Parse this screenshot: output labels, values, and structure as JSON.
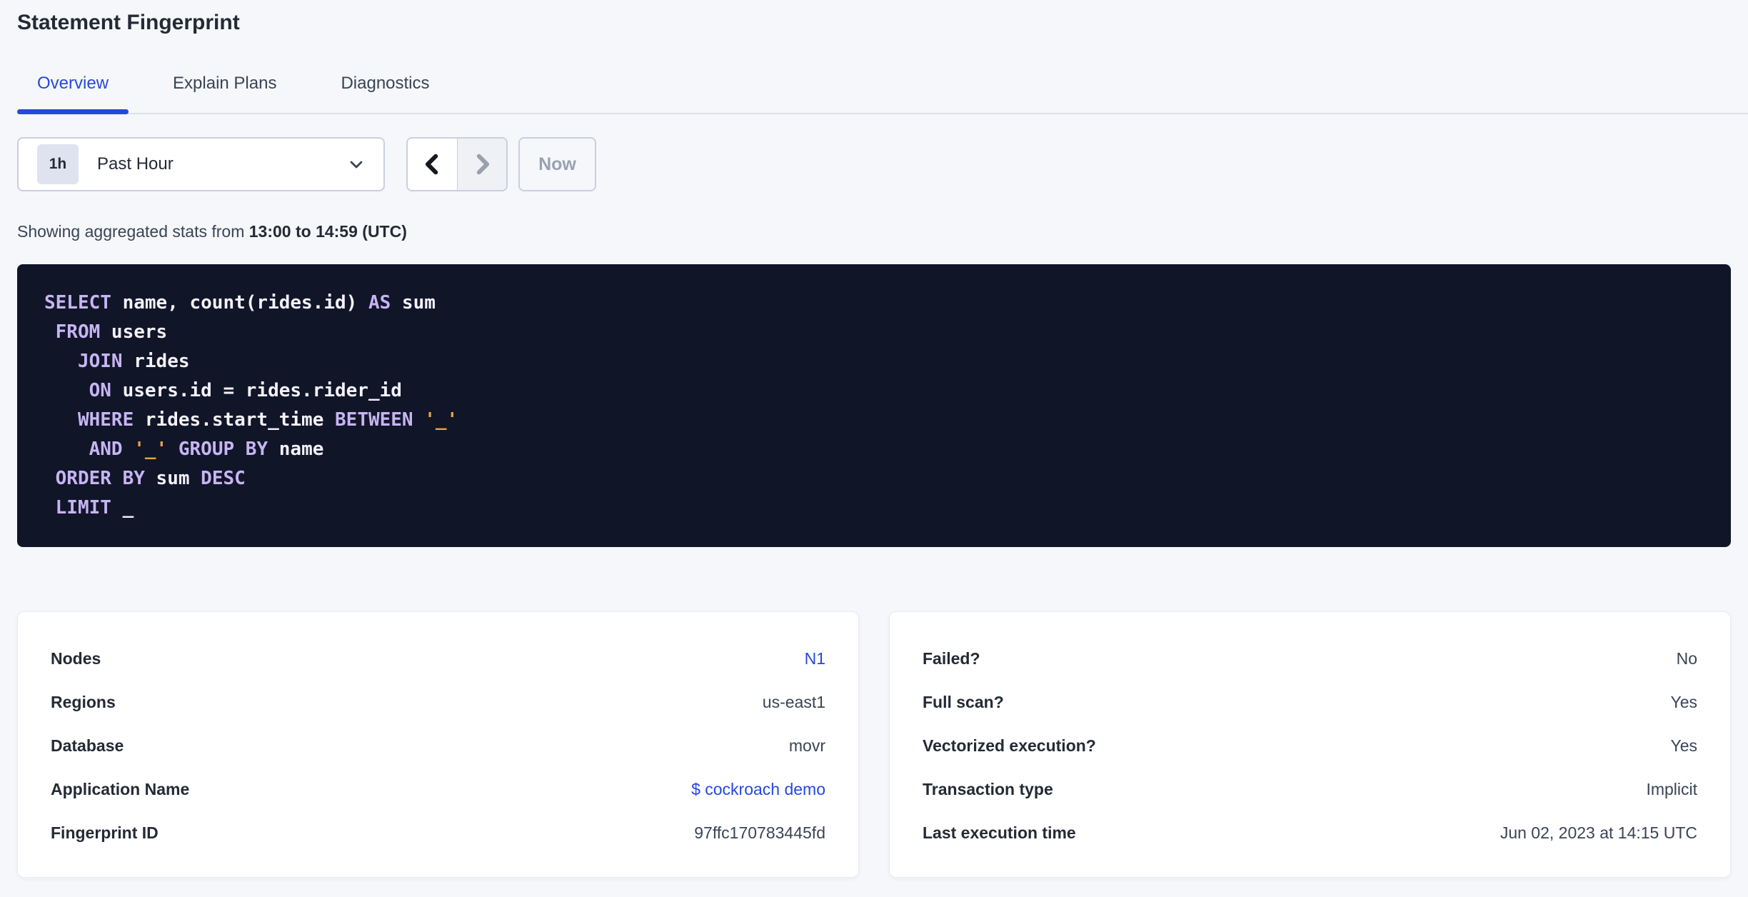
{
  "page": {
    "title": "Statement Fingerprint"
  },
  "colors": {
    "page_bg": "#f5f7fa",
    "accent_blue": "#2747e0",
    "text_dark": "#242a35",
    "text_base": "#394455",
    "code_bg": "#101528",
    "code_keyword": "#c7b5f2",
    "code_plain": "#f3f1fa",
    "code_literal": "#e8a24b"
  },
  "tabs": [
    {
      "id": "overview",
      "label": "Overview",
      "active": true
    },
    {
      "id": "explain-plans",
      "label": "Explain Plans",
      "active": false
    },
    {
      "id": "diagnostics",
      "label": "Diagnostics",
      "active": false
    }
  ],
  "toolbar": {
    "time_picker": {
      "badge": "1h",
      "label": "Past Hour",
      "chevron_icon": "chevron-down-icon"
    },
    "prev_button_icon": "chevron-left-icon",
    "next_button_icon": "chevron-right-icon",
    "next_button_disabled": true,
    "now_label": "Now",
    "now_button_disabled": true
  },
  "stats_line": {
    "prefix": "Showing aggregated stats from ",
    "range": "13:00 to 14:59 (UTC)"
  },
  "sql": {
    "lines": [
      [
        {
          "t": "SELECT",
          "y": "k"
        },
        {
          "t": " name, count(rides.id) ",
          "y": "p"
        },
        {
          "t": "AS",
          "y": "k"
        },
        {
          "t": " sum",
          "y": "p"
        }
      ],
      [
        {
          "t": " ",
          "y": "p"
        },
        {
          "t": "FROM",
          "y": "k"
        },
        {
          "t": " users",
          "y": "p"
        }
      ],
      [
        {
          "t": "   ",
          "y": "p"
        },
        {
          "t": "JOIN",
          "y": "k"
        },
        {
          "t": " rides",
          "y": "p"
        }
      ],
      [
        {
          "t": "    ",
          "y": "p"
        },
        {
          "t": "ON",
          "y": "k"
        },
        {
          "t": " users.id = rides.rider_id",
          "y": "p"
        }
      ],
      [
        {
          "t": "   ",
          "y": "p"
        },
        {
          "t": "WHERE",
          "y": "k"
        },
        {
          "t": " rides.start_time ",
          "y": "p"
        },
        {
          "t": "BETWEEN",
          "y": "k"
        },
        {
          "t": " ",
          "y": "p"
        },
        {
          "t": "'_'",
          "y": "s"
        }
      ],
      [
        {
          "t": "    ",
          "y": "p"
        },
        {
          "t": "AND",
          "y": "k"
        },
        {
          "t": " ",
          "y": "p"
        },
        {
          "t": "'_'",
          "y": "s"
        },
        {
          "t": " ",
          "y": "p"
        },
        {
          "t": "GROUP BY",
          "y": "k"
        },
        {
          "t": " name",
          "y": "p"
        }
      ],
      [
        {
          "t": " ",
          "y": "p"
        },
        {
          "t": "ORDER BY",
          "y": "k"
        },
        {
          "t": " sum ",
          "y": "p"
        },
        {
          "t": "DESC",
          "y": "k"
        }
      ],
      [
        {
          "t": " ",
          "y": "p"
        },
        {
          "t": "LIMIT",
          "y": "k"
        },
        {
          "t": " _",
          "y": "p"
        }
      ]
    ]
  },
  "cards": {
    "left": [
      {
        "label": "Nodes",
        "value": "N1",
        "link": true
      },
      {
        "label": "Regions",
        "value": "us-east1",
        "link": false
      },
      {
        "label": "Database",
        "value": "movr",
        "link": false
      },
      {
        "label": "Application Name",
        "value": "$ cockroach demo",
        "link": true
      },
      {
        "label": "Fingerprint ID",
        "value": "97ffc170783445fd",
        "link": false
      }
    ],
    "right": [
      {
        "label": "Failed?",
        "value": "No",
        "link": false
      },
      {
        "label": "Full scan?",
        "value": "Yes",
        "link": false
      },
      {
        "label": "Vectorized execution?",
        "value": "Yes",
        "link": false
      },
      {
        "label": "Transaction type",
        "value": "Implicit",
        "link": false
      },
      {
        "label": "Last execution time",
        "value": "Jun 02, 2023 at 14:15 UTC",
        "link": false
      }
    ]
  }
}
